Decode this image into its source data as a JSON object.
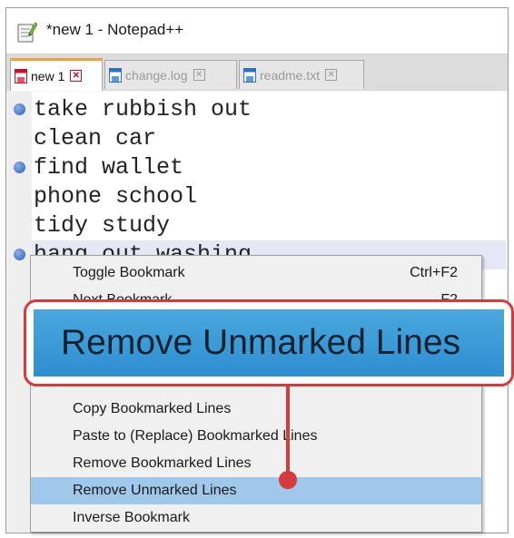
{
  "window": {
    "title": "*new 1 - Notepad++"
  },
  "tabs": [
    {
      "label": "new 1",
      "active": true
    },
    {
      "label": "change.log",
      "active": false
    },
    {
      "label": "readme.txt",
      "active": false
    }
  ],
  "editor": {
    "lines": [
      {
        "text": "take rubbish out",
        "bookmarked": true
      },
      {
        "text": "clean car",
        "bookmarked": false
      },
      {
        "text": "find wallet",
        "bookmarked": true
      },
      {
        "text": "phone school",
        "bookmarked": false
      },
      {
        "text": "tidy study",
        "bookmarked": false
      },
      {
        "text": "hang out washing",
        "bookmarked": true
      }
    ]
  },
  "context_menu": {
    "items": [
      {
        "label": "Toggle Bookmark",
        "shortcut": "Ctrl+F2"
      },
      {
        "label": "Next Bookmark",
        "shortcut": "F2"
      },
      {
        "label": "Copy Bookmarked Lines",
        "shortcut": ""
      },
      {
        "label": "Paste to (Replace) Bookmarked Lines",
        "shortcut": ""
      },
      {
        "label": "Remove Bookmarked Lines",
        "shortcut": ""
      },
      {
        "label": "Remove Unmarked Lines",
        "shortcut": "",
        "highlighted": true
      },
      {
        "label": "Inverse Bookmark",
        "shortcut": ""
      }
    ]
  },
  "callout": {
    "text": "Remove Unmarked Lines"
  },
  "colors": {
    "tab_accent": "#f0a23a",
    "bookmark": "#2e5fb3",
    "highlight": "#9fc8ea",
    "callout_border": "#d63a3a",
    "callout_fill": "#3a9ad6"
  }
}
